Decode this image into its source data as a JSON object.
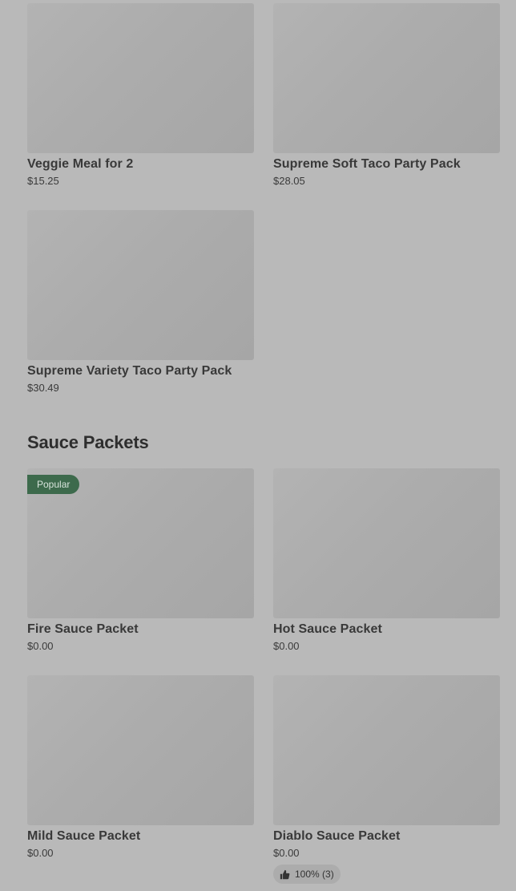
{
  "upper_items": [
    {
      "name": "Veggie Meal for 2",
      "price": "$15.25"
    },
    {
      "name": "Supreme Soft Taco Party Pack",
      "price": "$28.05"
    },
    {
      "name": "Supreme Variety Taco Party Pack",
      "price": "$30.49"
    }
  ],
  "sauce_section": {
    "title": "Sauce Packets",
    "items": [
      {
        "name": "Fire Sauce Packet",
        "price": "$0.00",
        "badge": "Popular"
      },
      {
        "name": "Hot Sauce Packet",
        "price": "$0.00"
      },
      {
        "name": "Mild Sauce Packet",
        "price": "$0.00"
      },
      {
        "name": "Diablo Sauce Packet",
        "price": "$0.00",
        "rating": "100% (3)",
        "rating_icon": "thumbs-up-icon"
      }
    ]
  },
  "colors": {
    "background": "#b9b9b9",
    "badge": "#3d6a4c",
    "image_placeholder": "#acacac"
  }
}
